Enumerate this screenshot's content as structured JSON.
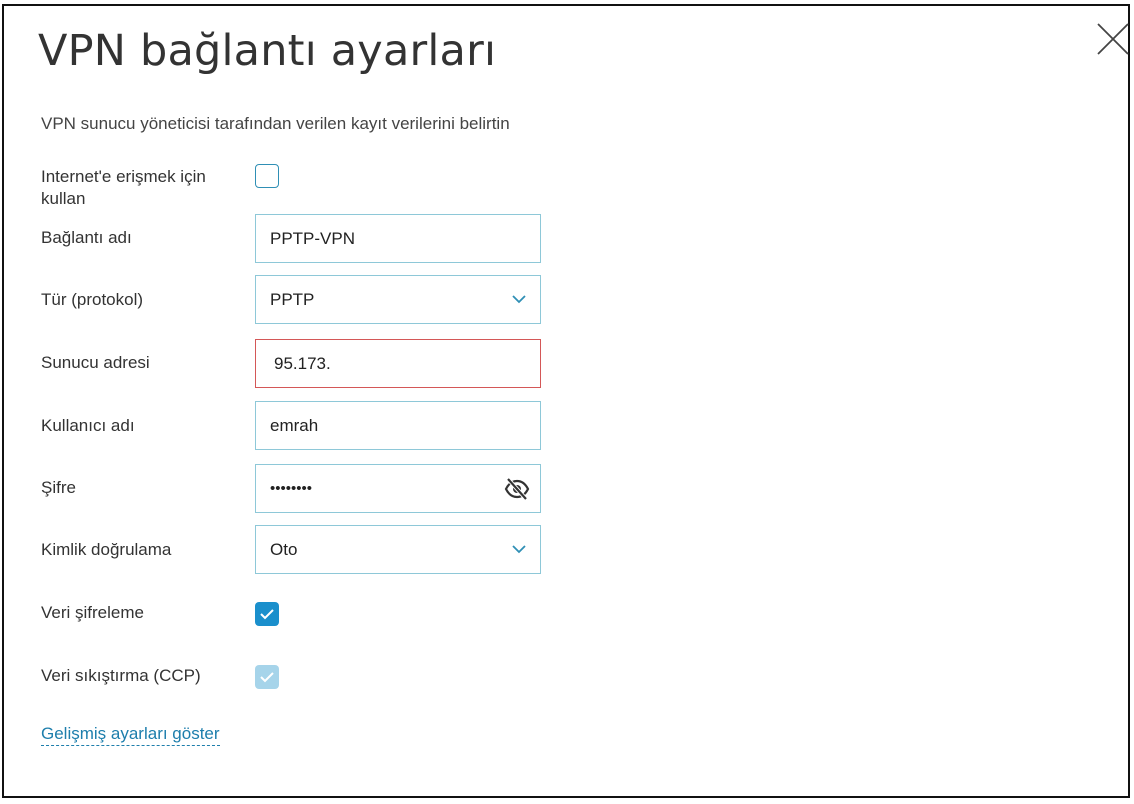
{
  "dialog": {
    "title": "VPN bağlantı ayarları",
    "subtitle": "VPN sunucu yöneticisi tarafından verilen kayıt verilerini belirtin",
    "close_icon": "close-icon"
  },
  "form": {
    "internet_access": {
      "label": "Internet'e erişmek için kullan",
      "checked": false
    },
    "connection_name": {
      "label": "Bağlantı adı",
      "value": "PPTP-VPN"
    },
    "protocol": {
      "label": "Tür (protokol)",
      "value": "PPTP"
    },
    "server_address": {
      "label": "Sunucu adresi",
      "value": "95.173."
    },
    "username": {
      "label": "Kullanıcı adı",
      "value": "emrah"
    },
    "password": {
      "label": "Şifre",
      "masked_value": "••••••••",
      "toggle_icon": "eye-off-icon"
    },
    "authentication": {
      "label": "Kimlik doğrulama",
      "value": "Oto"
    },
    "data_encryption": {
      "label": "Veri şifreleme",
      "checked": true
    },
    "data_compression": {
      "label": "Veri sıkıştırma (CCP)",
      "checked": true,
      "disabled": true
    },
    "advanced_link": "Gelişmiş ayarları göster"
  },
  "colors": {
    "field_border": "#8ec8d8",
    "error_border": "#d45757",
    "checkbox_checked": "#1a8fcc",
    "checkbox_disabled": "#a6d4ea",
    "link": "#1d7eac"
  }
}
